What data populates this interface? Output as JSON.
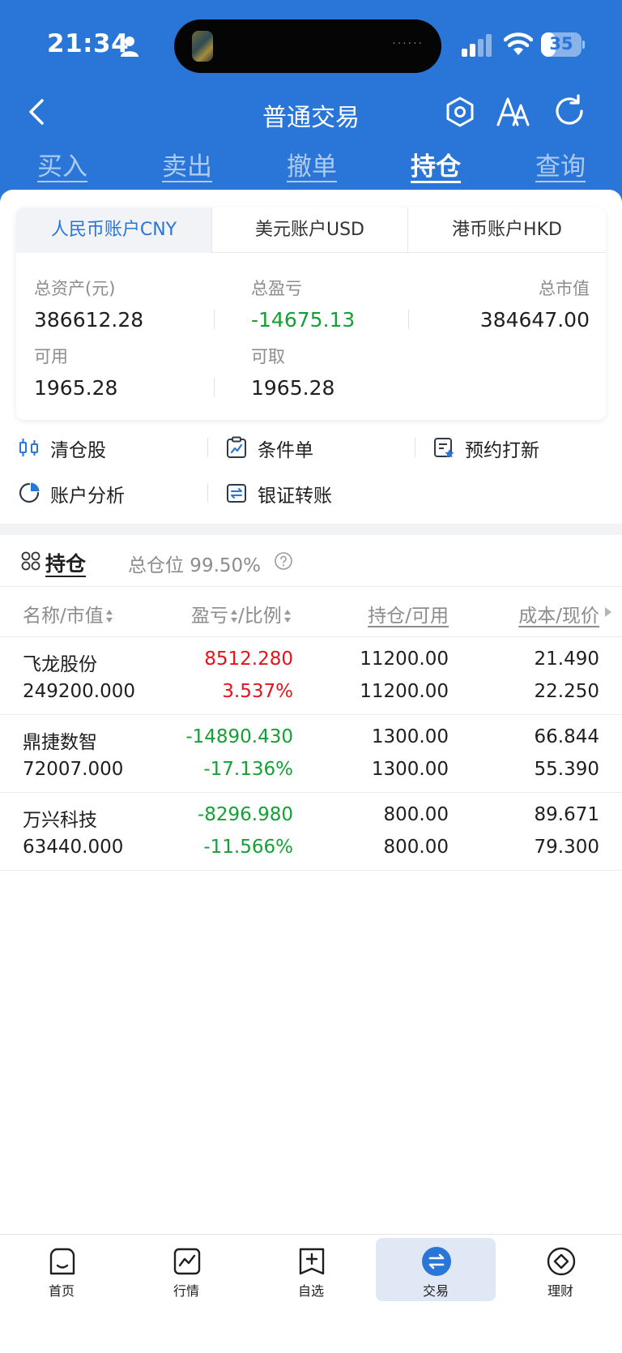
{
  "status_bar": {
    "time": "21:34",
    "battery": "35",
    "battery_level": 0.35
  },
  "nav": {
    "title": "普通交易"
  },
  "trade_tabs": [
    {
      "label": "买入",
      "active": false
    },
    {
      "label": "卖出",
      "active": false
    },
    {
      "label": "撤单",
      "active": false
    },
    {
      "label": "持仓",
      "active": true
    },
    {
      "label": "查询",
      "active": false
    }
  ],
  "account_tabs": [
    {
      "label": "人民币账户CNY",
      "active": true
    },
    {
      "label": "美元账户USD",
      "active": false
    },
    {
      "label": "港币账户HKD",
      "active": false
    }
  ],
  "summary": {
    "total_assets_label": "总资产(元)",
    "total_assets": "386612.28",
    "total_pl_label": "总盈亏",
    "total_pl": "-14675.13",
    "market_value_label": "总市值",
    "market_value": "384647.00",
    "available_label": "可用",
    "available": "1965.28",
    "withdrawable_label": "可取",
    "withdrawable": "1965.28"
  },
  "actions": [
    {
      "label": "清仓股",
      "icon": "clear-position-icon"
    },
    {
      "label": "条件单",
      "icon": "conditional-order-icon"
    },
    {
      "label": "预约打新",
      "icon": "ipo-subscribe-icon"
    },
    {
      "label": "账户分析",
      "icon": "pie-chart-icon"
    },
    {
      "label": "银证转账",
      "icon": "bank-transfer-icon"
    }
  ],
  "holdings": {
    "title": "持仓",
    "ratio_label": "总仓位 99.50%",
    "columns": {
      "name_mv": "名称/市值",
      "pl_ratio": "盈亏",
      "pl_ratio2": "/比例",
      "position": "持仓/可用",
      "cost_price": "成本/现价"
    },
    "rows": [
      {
        "name": "飞龙股份",
        "market_value": "249200.000",
        "pl": "8512.280",
        "pl_ratio": "3.537%",
        "position": "11200.00",
        "available": "11200.00",
        "cost": "21.490",
        "price": "22.250",
        "dir": "up"
      },
      {
        "name": "鼎捷数智",
        "market_value": "72007.000",
        "pl": "-14890.430",
        "pl_ratio": "-17.136%",
        "position": "1300.00",
        "available": "1300.00",
        "cost": "66.844",
        "price": "55.390",
        "dir": "down"
      },
      {
        "name": "万兴科技",
        "market_value": "63440.000",
        "pl": "-8296.980",
        "pl_ratio": "-11.566%",
        "position": "800.00",
        "available": "800.00",
        "cost": "89.671",
        "price": "79.300",
        "dir": "down"
      }
    ]
  },
  "bottom_nav": [
    {
      "label": "首页",
      "icon": "home-icon",
      "active": false
    },
    {
      "label": "行情",
      "icon": "market-chart-icon",
      "active": false
    },
    {
      "label": "自选",
      "icon": "watchlist-icon",
      "active": false
    },
    {
      "label": "交易",
      "icon": "trade-icon",
      "active": true
    },
    {
      "label": "理财",
      "icon": "wealth-icon",
      "active": false
    }
  ],
  "colors": {
    "brand": "#2a75d8",
    "gain": "#e8121b",
    "loss": "#15a035"
  }
}
